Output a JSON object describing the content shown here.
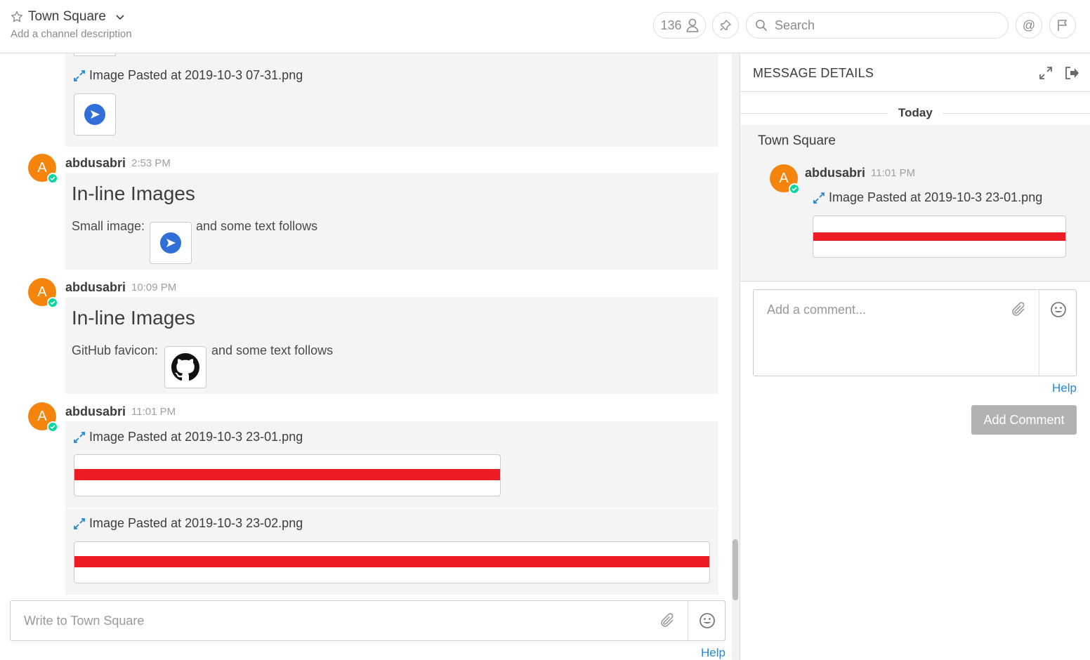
{
  "header": {
    "channel_name": "Town Square",
    "channel_description": "Add a channel description",
    "member_count": "136",
    "search_placeholder": "Search",
    "at_label": "@"
  },
  "posts": [
    {
      "file_name": "Image Pasted at 2019-10-3 07-31.png"
    },
    {
      "avatar_initial": "A",
      "username": "abdusabri",
      "time": "2:53 PM",
      "heading": "In-line Images",
      "text_before": "Small image:",
      "text_after": "and some text follows"
    },
    {
      "avatar_initial": "A",
      "username": "abdusabri",
      "time": "10:09 PM",
      "heading": "In-line Images",
      "text_before": "GitHub favicon:",
      "text_after": "and some text follows"
    },
    {
      "avatar_initial": "A",
      "username": "abdusabri",
      "time": "11:01 PM",
      "file_name": "Image Pasted at 2019-10-3 23-01.png"
    },
    {
      "file_name": "Image Pasted at 2019-10-3 23-02.png"
    }
  ],
  "composer": {
    "placeholder": "Write to Town Square",
    "help": "Help"
  },
  "rhs": {
    "title": "MESSAGE DETAILS",
    "date_separator": "Today",
    "channel": "Town Square",
    "avatar_initial": "A",
    "username": "abdusabri",
    "time": "11:01 PM",
    "file_name": "Image Pasted at 2019-10-3 23-01.png",
    "comment_placeholder": "Add a comment...",
    "help": "Help",
    "add_comment": "Add Comment"
  },
  "colors": {
    "avatar": "#f5840c",
    "status_online": "#06d6a0",
    "link": "#2389d7",
    "image_stripe": "#ed1c24",
    "accent_blue": "#2f6fd7"
  }
}
